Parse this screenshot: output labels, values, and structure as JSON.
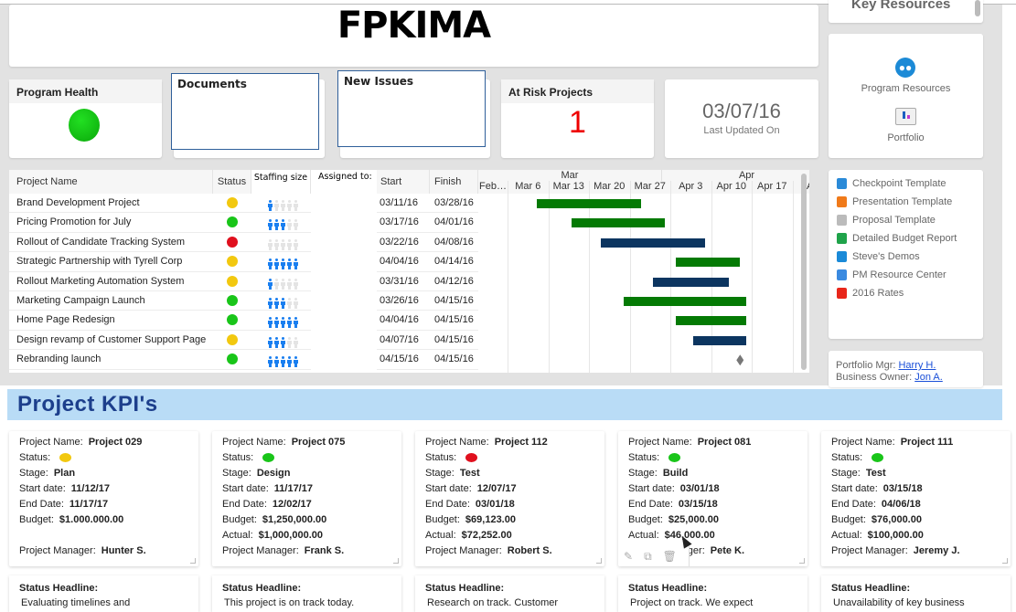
{
  "title": "FPKIMA",
  "tiles": {
    "program_health": "Program Health",
    "documents": "Documents",
    "new_issues": "New Issues",
    "at_risk": "At Risk Projects",
    "at_risk_count": "1",
    "last_updated": "03/07/16",
    "last_updated_label": "Last Updated On"
  },
  "sidebar": {
    "key_resources": "Key Resources",
    "program_resources": "Program Resources",
    "portfolio": "Portfolio",
    "links": [
      {
        "label": "Checkpoint Template",
        "icon": "word-doc-icon",
        "color": "#2a8ad8"
      },
      {
        "label": "Presentation Template",
        "icon": "powerpoint-icon",
        "color": "#f07a1a"
      },
      {
        "label": "Proposal Template",
        "icon": "document-icon",
        "color": "#bbbbbb"
      },
      {
        "label": "Detailed Budget Report",
        "icon": "excel-icon",
        "color": "#1fa34a"
      },
      {
        "label": "Steve's Demos",
        "icon": "people-icon",
        "color": "#1a8ad8"
      },
      {
        "label": "PM Resource Center",
        "icon": "link-icon",
        "color": "#3a8ae0"
      },
      {
        "label": "2016 Rates",
        "icon": "pdf-icon",
        "color": "#e8261a"
      }
    ],
    "portfolio_mgr_label": "Portfolio Mgr:",
    "portfolio_mgr": "Harry H.",
    "business_owner_label": "Business Owner:",
    "business_owner": "Jon A."
  },
  "table": {
    "headers": {
      "name": "Project Name",
      "status": "Status",
      "staffing": "Staffing size",
      "assigned": "Assigned to:",
      "start": "Start",
      "finish": "Finish"
    },
    "months": [
      "Mar",
      "Apr"
    ],
    "weeks": [
      "Feb…",
      "Mar 6",
      "Mar 13",
      "Mar 20",
      "Mar 27",
      "Apr 3",
      "Apr 10",
      "Apr 17",
      "Ap"
    ],
    "rows": [
      {
        "name": "Brand Development Project",
        "status": "yellow",
        "staffing": 1,
        "start": "03/11/16",
        "finish": "03/28/16",
        "bar": "green"
      },
      {
        "name": "Pricing Promotion for July",
        "status": "green",
        "staffing": 3,
        "start": "03/17/16",
        "finish": "04/01/16",
        "bar": "green"
      },
      {
        "name": "Rollout of Candidate Tracking System",
        "status": "red",
        "staffing": 0,
        "start": "03/22/16",
        "finish": "04/08/16",
        "bar": "navy"
      },
      {
        "name": "Strategic Partnership with Tyrell Corp",
        "status": "yellow",
        "staffing": 5,
        "start": "04/04/16",
        "finish": "04/14/16",
        "bar": "green"
      },
      {
        "name": "Rollout Marketing Automation System",
        "status": "yellow",
        "staffing": 1,
        "start": "03/31/16",
        "finish": "04/12/16",
        "bar": "navy"
      },
      {
        "name": "Marketing Campaign Launch",
        "status": "green",
        "staffing": 3,
        "start": "03/26/16",
        "finish": "04/15/16",
        "bar": "green"
      },
      {
        "name": "Home Page Redesign",
        "status": "green",
        "staffing": 5,
        "start": "04/04/16",
        "finish": "04/15/16",
        "bar": "green"
      },
      {
        "name": "Design revamp of Customer Support Page",
        "status": "yellow",
        "staffing": 3,
        "start": "04/07/16",
        "finish": "04/15/16",
        "bar": "navy"
      },
      {
        "name": "Rebranding launch",
        "status": "green",
        "staffing": 5,
        "start": "04/15/16",
        "finish": "04/15/16",
        "bar": "milestone"
      }
    ]
  },
  "colors": {
    "yellow": "#f2c80f",
    "green": "#19c519",
    "red": "#e0101e",
    "bar_green": "#047a04",
    "bar_navy": "#0c3560",
    "milestone": "#777777",
    "staff_on": "#1a7ff0",
    "staff_off": "#e4e4e4",
    "kpi_header": "#b9dcf6",
    "kpi_title": "#1d3f8c"
  },
  "kpi": {
    "title": "Project KPI's",
    "labels": {
      "name": "Project Name:",
      "status": "Status:",
      "stage": "Stage:",
      "start": "Start date:",
      "end": "End Date:",
      "budget": "Budget:",
      "actual": "Actual:",
      "pm": "Project Manager:",
      "headline": "Status Headline:"
    },
    "cards": [
      {
        "name": "Project 029",
        "status": "yellow",
        "stage": "Plan",
        "start": "11/12/17",
        "end": "11/17/17",
        "budget": "$1.000.000.00",
        "actual": "",
        "pm": "Hunter S.",
        "headline": "Evaluating timelines and"
      },
      {
        "name": "Project 075",
        "status": "green",
        "stage": "Design",
        "start": "11/17/17",
        "end": "12/02/17",
        "budget": "$1,250,000.00",
        "actual": "$1,000,000.00",
        "pm": "Frank S.",
        "headline": "This project is on track today."
      },
      {
        "name": "Project 112",
        "status": "red",
        "stage": "Test",
        "start": "12/07/17",
        "end": "03/01/18",
        "budget": "$69,123.00",
        "actual": "$72,252.00",
        "pm": "Robert S.",
        "headline": "Research on track. Customer"
      },
      {
        "name": "Project 081",
        "status": "green",
        "stage": "Build",
        "start": "03/01/18",
        "end": "03/15/18",
        "budget": "$25,000.00",
        "actual": "$46,000.00",
        "pm": "Pete K.",
        "headline": "Project on track. We expect"
      },
      {
        "name": "Project 111",
        "status": "green",
        "stage": "Test",
        "start": "03/15/18",
        "end": "04/06/18",
        "budget": "$76,000.00",
        "actual": "$100,000.00",
        "pm": "Jeremy J.",
        "headline": "Unavailability of key business"
      }
    ]
  }
}
